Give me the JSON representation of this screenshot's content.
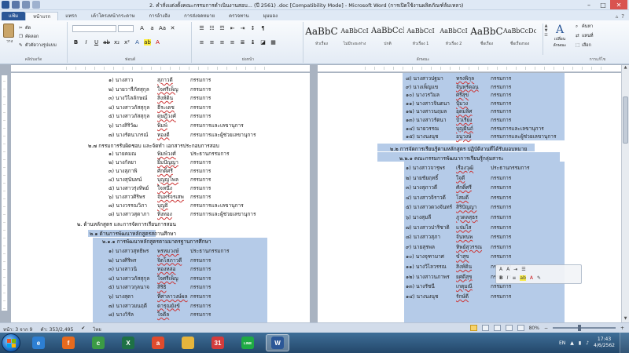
{
  "window": {
    "title": "2. คำสั่งแต่งตั้งคณะกรรมการดำเนินงานสอบ...  (ปี 2561) .doc [Compatibility Mode] - Microsoft Word (การเปิดใช้งานผลิตภัณฑ์ล้มเหลว)"
  },
  "tabs": [
    "แฟ้ม",
    "หน้าแรก",
    "แทรก",
    "เค้าโครงหน้ากระดาษ",
    "การอ้างอิง",
    "การส่งจดหมาย",
    "ตรวจทาน",
    "มุมมอง"
  ],
  "ribbon": {
    "paste_label": "วาง",
    "cut_label": "ตัด",
    "copy_label": "คัดลอก",
    "painter_label": "ตัวคัดวางรูปแบบ",
    "clipboard_group": "คลิปบอร์ด",
    "font_group": "ฟอนต์",
    "paragraph_group": "ย่อหน้า",
    "styles_group": "ลักษณะ",
    "editing_group": "การแก้ไข",
    "styles": [
      {
        "sample": "AaBbC",
        "name": "หัวเรื่อง"
      },
      {
        "sample": "AaBbCcI",
        "name": "ไม่มีระยะห่าง"
      },
      {
        "sample": "AaBbCcI",
        "name": "ปกติ"
      },
      {
        "sample": "AaBbCcI",
        "name": "หัวเรื่อง 1"
      },
      {
        "sample": "AaBbCcI",
        "name": "หัวเรื่อง 2"
      },
      {
        "sample": "AaBbC",
        "name": "ชื่อเรื่อง"
      },
      {
        "sample": "AaBbCcDc",
        "name": "ชื่อเรื่องรอง"
      }
    ],
    "change_styles": "เปลี่ยนลักษณะ",
    "find_label": "ค้นหา",
    "replace_label": "แทนที่",
    "select_label": "เลือก"
  },
  "left_page": {
    "section_heading_1": "๒.๗ กรรมการรับผิดชอบ และจัดทำ เอกสารประกอบการสอบ",
    "section_heading_2": "๒. ด้านหลักสูตร และการจัดการเรียนการสอน",
    "sub_heading_1": "๒.๑ ด้านการพัฒนาหลักสูตรสถานศึกษา",
    "sub_heading_2": "๒.๑.๑ การพัฒนาหลักสูตรตามมาตรฐานการศึกษา",
    "rows_top": [
      {
        "no": "๑) นางสาว",
        "name": "สุภาวดี",
        "role": "กรรมการ"
      },
      {
        "no": "๒) นายวารีภัสสุกุล",
        "name": "ใจศรีเพ็ญ",
        "role": "กรรมการ"
      },
      {
        "no": "๓) นางวิไลลักษณ์",
        "name": "สิงห์ดิน",
        "role": "กรรมการ"
      },
      {
        "no": "๔) นางสาวภัสสุกุล",
        "name": "ธีระเดช",
        "role": "กรรมการ"
      },
      {
        "no": "๕) นางสาวภัสสุกุล",
        "name": "ดุษฎีวงศ์",
        "role": "กรรมการ"
      },
      {
        "no": "๖) นางสิริวัฒ",
        "name": "พิมพ์",
        "role": "กรรมการและเลขานุการ"
      },
      {
        "no": "๗) นางรัตนาภรณ์",
        "name": "ทองดี",
        "role": "กรรมการและผู้ช่วยเลขานุการ"
      }
    ],
    "rows_mid": [
      {
        "no": "๑) นายคมณ",
        "name": "พิมพ์วงศ์",
        "role": "ประธานกรรมการ"
      },
      {
        "no": "๒) นางกัลยา",
        "name": "ยิ้มปัญญา",
        "role": "กรรมการ"
      },
      {
        "no": "๓) นางสุภาพิ",
        "name": "ศักดิ์ศรี",
        "role": "กรรมการ"
      },
      {
        "no": "๔) นางสุนันทน์",
        "name": "บุญญโพล",
        "role": "กรรมการ"
      },
      {
        "no": "๕) นางสาวรุ่งทิพย์",
        "name": "ใจหนึ่ง",
        "role": "กรรมการ"
      },
      {
        "no": "๖) นางสาวศิริพร",
        "name": "จันทร์จรเสพ",
        "role": "กรรมการ"
      },
      {
        "no": "๗) นางวรรณวิภา",
        "name": "บุญธิ",
        "role": "กรรมการและเลขานุการ"
      },
      {
        "no": "๘) นางสาวสุดาภา",
        "name": "ทิ่งทอง",
        "role": "กรรมการและผู้ช่วยเลขานุการ"
      }
    ],
    "rows_bottom": [
      {
        "no": "๑) นางสาวสุทธิพร",
        "name": "พรหมวงษ์",
        "role": "ประธานกรรมการ"
      },
      {
        "no": "๒) นางศิริพร",
        "name": "จิตโสภาวดี",
        "role": "กรรมการ"
      },
      {
        "no": "๓) นางสาวนิ",
        "name": "ทองหล่อ",
        "role": "กรรมการ"
      },
      {
        "no": "๔) นางสาวภัสสุกุล",
        "name": "ใจศรีเพ็ญ",
        "role": "กรรมการ"
      },
      {
        "no": "๕) นางสาวกุลนาจ",
        "name": "สิริธิ",
        "role": "กรรมการ"
      },
      {
        "no": "๖) นางสุดา",
        "name": "ที่ศาลาวงษ์ผล",
        "role": "กรรมการ"
      },
      {
        "no": "๗) นางสาวมนฤดี",
        "name": "ดารุณยังข์",
        "role": "กรรมการ"
      },
      {
        "no": "๘) นางวิรัล",
        "name": "ใจดีล",
        "role": "กรรมการ"
      }
    ]
  },
  "right_page": {
    "rows_top": [
      {
        "no": "๘) นางสาวปฐมา",
        "name": "ทรงพิกุล",
        "role": "กรรมการ"
      },
      {
        "no": "๙) นางเพ็ญแข",
        "name": "จันทร์ดอน",
        "role": "กรรมการ"
      },
      {
        "no": "๑๐) นางวรวิมล",
        "name": "ศรีสุข",
        "role": "กรรมการ"
      },
      {
        "no": "๑๑) นางสาวจินตนา",
        "name": "ปุ้มวง",
        "role": "กรรมการ"
      },
      {
        "no": "๑๒) นางสาวนฤมล",
        "name": "อุดมลิศ",
        "role": "กรรมการ"
      },
      {
        "no": "๑๓) นางสาวรัตนา",
        "name": "บัวเรียง",
        "role": "กรรมการ"
      },
      {
        "no": "๑๔) นายวรรณ",
        "name": "บุญยืนถ์",
        "role": "กรรมการและเลขานุการ"
      },
      {
        "no": "๑๕) นางนงนุช",
        "name": "อนุวงษ์",
        "role": "กรรมการและผู้ช่วยเลขานุการ"
      }
    ],
    "heading_1": "๒.๒ การจัดการเรียนรู้ตามหลักสูตร ปฏิบัติงานที่ได้รับมอบหมาย",
    "heading_2": "๒.๒.๑ คณะกรรมการพัฒนาการเรียนรู้กลุ่มสาระ",
    "rows_bottom": [
      {
        "no": "๑) นางสาวจารุพร",
        "name": "เรืองวุฒิ",
        "role": "ประธานกรรมการ"
      },
      {
        "no": "๒) นายชัยฤทธิ์",
        "name": "ใจดี",
        "role": "กรรมการ"
      },
      {
        "no": "๓) นางสุภาวดี",
        "name": "ศักดิ์ศรี",
        "role": "กรรมการ"
      },
      {
        "no": "๔) นางสาวจิราวดี",
        "name": "โสมดี",
        "role": "กรรมการ"
      },
      {
        "no": "๕) นางสาวดวงจันทร์",
        "name": "สิริปัญญา",
        "role": "กรรมการ"
      },
      {
        "no": "๖) นางสุมลี",
        "name": "ภูวดลสุธร",
        "role": "กรรมการ"
      },
      {
        "no": "๗) นางสาวปาริชาติ",
        "name": "แจ่มใส",
        "role": "กรรมการ"
      },
      {
        "no": "๘) นางสาวสุภา",
        "name": "จันทนพ",
        "role": "กรรมการ"
      },
      {
        "no": "๙) นายสุรพล",
        "name": "ทิพย์สุวรรณ",
        "role": "กรรมการ"
      },
      {
        "no": "๑๐) นางจุฑามาศ",
        "name": "ขำสุข",
        "role": "กรรมการ"
      },
      {
        "no": "๑๑) นางวิไลวรรณ",
        "name": "สิงห์ดิน",
        "role": "กรรมการ"
      },
      {
        "no": "๑๒) นางสาวนภาพร",
        "name": "ยศดีสุข",
        "role": "กรรมการ"
      },
      {
        "no": "๑๓) นางรัชนี",
        "name": "เกตุมณี",
        "role": "กรรมการ"
      },
      {
        "no": "๑๔) นางนงนุช",
        "name": "รักษ์ดี",
        "role": "กรรมการ"
      }
    ]
  },
  "statusbar": {
    "page": "หน้า: 3 จาก 9",
    "words": "คำ: 353/2,495",
    "lang": "ไทย",
    "zoom": "80%"
  },
  "taskbar": {
    "time": "17:43",
    "date": "4/6/2562",
    "lang": "EN",
    "apps": [
      {
        "name": "ie-icon",
        "color": "#2d7fd3",
        "glyph": "e"
      },
      {
        "name": "firefox-icon",
        "color": "#e66a1e",
        "glyph": "f"
      },
      {
        "name": "chrome-icon",
        "color": "#3b9b45",
        "glyph": "c"
      },
      {
        "name": "excel-icon",
        "color": "#1e7145",
        "glyph": "X"
      },
      {
        "name": "app-icon",
        "color": "#e04b2d",
        "glyph": "a"
      },
      {
        "name": "folder-icon",
        "color": "#e6b53c",
        "glyph": ""
      },
      {
        "name": "calendar-icon",
        "color": "#d33c3c",
        "glyph": "31"
      },
      {
        "name": "line-icon",
        "color": "#1faa44",
        "glyph": "LINE"
      },
      {
        "name": "word-icon",
        "color": "#2b5797",
        "glyph": "W"
      }
    ]
  }
}
